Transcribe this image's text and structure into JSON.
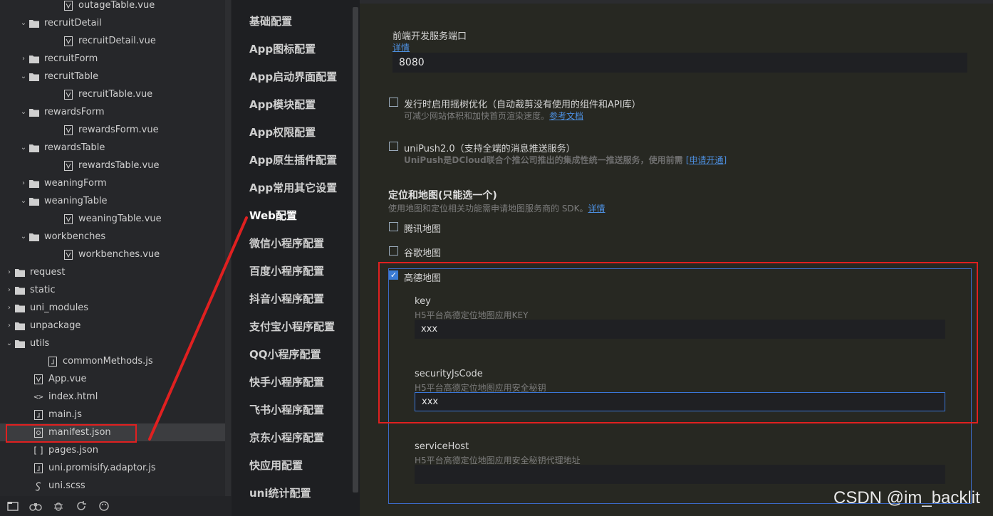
{
  "tree": [
    {
      "label": "outageTable.vue",
      "type": "vue",
      "chev": ""
    },
    {
      "label": "recruitDetail",
      "type": "folder",
      "chev": "open"
    },
    {
      "label": "recruitDetail.vue",
      "type": "vue",
      "chev": ""
    },
    {
      "label": "recruitForm",
      "type": "folder",
      "chev": "closed"
    },
    {
      "label": "recruitTable",
      "type": "folder",
      "chev": "open"
    },
    {
      "label": "recruitTable.vue",
      "type": "vue",
      "chev": ""
    },
    {
      "label": "rewardsForm",
      "type": "folder",
      "chev": "open"
    },
    {
      "label": "rewardsForm.vue",
      "type": "vue",
      "chev": ""
    },
    {
      "label": "rewardsTable",
      "type": "folder",
      "chev": "open"
    },
    {
      "label": "rewardsTable.vue",
      "type": "vue",
      "chev": ""
    },
    {
      "label": "weaningForm",
      "type": "folder",
      "chev": "closed"
    },
    {
      "label": "weaningTable",
      "type": "folder",
      "chev": "open"
    },
    {
      "label": "weaningTable.vue",
      "type": "vue",
      "chev": ""
    },
    {
      "label": "workbenches",
      "type": "folder",
      "chev": "open"
    },
    {
      "label": "workbenches.vue",
      "type": "vue",
      "chev": ""
    },
    {
      "label": "request",
      "type": "folder",
      "chev": "closed"
    },
    {
      "label": "static",
      "type": "folder",
      "chev": "closed"
    },
    {
      "label": "uni_modules",
      "type": "folder",
      "chev": "closed"
    },
    {
      "label": "unpackage",
      "type": "folder",
      "chev": "closed"
    },
    {
      "label": "utils",
      "type": "folder",
      "chev": "open"
    },
    {
      "label": "commonMethods.js",
      "type": "js",
      "chev": ""
    },
    {
      "label": "App.vue",
      "type": "vue",
      "chev": ""
    },
    {
      "label": "index.html",
      "type": "html",
      "chev": ""
    },
    {
      "label": "main.js",
      "type": "js",
      "chev": ""
    },
    {
      "label": "manifest.json",
      "type": "settings",
      "chev": ""
    },
    {
      "label": "pages.json",
      "type": "json",
      "chev": ""
    },
    {
      "label": "uni.promisify.adaptor.js",
      "type": "js",
      "chev": ""
    },
    {
      "label": "uni.scss",
      "type": "scss",
      "chev": ""
    }
  ],
  "tree_selected": "manifest.json",
  "nav": [
    "基础配置",
    "App图标配置",
    "App启动界面配置",
    "App模块配置",
    "App权限配置",
    "App原生插件配置",
    "App常用其它设置",
    "Web配置",
    "微信小程序配置",
    "百度小程序配置",
    "抖音小程序配置",
    "支付宝小程序配置",
    "QQ小程序配置",
    "快手小程序配置",
    "飞书小程序配置",
    "京东小程序配置",
    "快应用配置",
    "uni统计配置"
  ],
  "nav_active": "Web配置",
  "content": {
    "port_label": "前端开发服务端口",
    "port_detail": "详情",
    "port_value": "8080",
    "treeshake_label": "发行时启用摇树优化（自动裁剪没有使用的组件和API库）",
    "treeshake_sub": "可减少网站体积和加快首页渲染速度。",
    "treeshake_link": "参考文档",
    "unipush_label": "uniPush2.0（支持全端的消息推送服务）",
    "unipush_sub": "UniPush是DCloud联合个推公司推出的集成性统一推送服务，使用前需",
    "unipush_link": "[申请开通]",
    "map_title": "定位和地图(只能选一个)",
    "map_sub": "使用地图和定位相关功能需申请地图服务商的 SDK。",
    "map_detail": "详情",
    "tencent_label": "腾讯地图",
    "google_label": "谷歌地图",
    "amap_label": "高德地图",
    "key_label": "key",
    "key_sub": "H5平台高德定位地图应用KEY",
    "key_value": "xxx",
    "security_label": "securityJsCode",
    "security_sub": "H5平台高德定位地图应用安全秘钥",
    "security_value": "xxx",
    "servicehost_label": "serviceHost",
    "servicehost_sub": "H5平台高德定位地图应用安全秘钥代理地址",
    "servicehost_value": ""
  },
  "checkboxes": {
    "treeshake": false,
    "unipush": false,
    "tencent": false,
    "google": false,
    "amap": true
  },
  "watermark": "CSDN @im_backlit",
  "colors": {
    "annotation_red": "#e02020",
    "accent_blue": "#3a7bd5",
    "link_blue": "#4d8fe0"
  }
}
